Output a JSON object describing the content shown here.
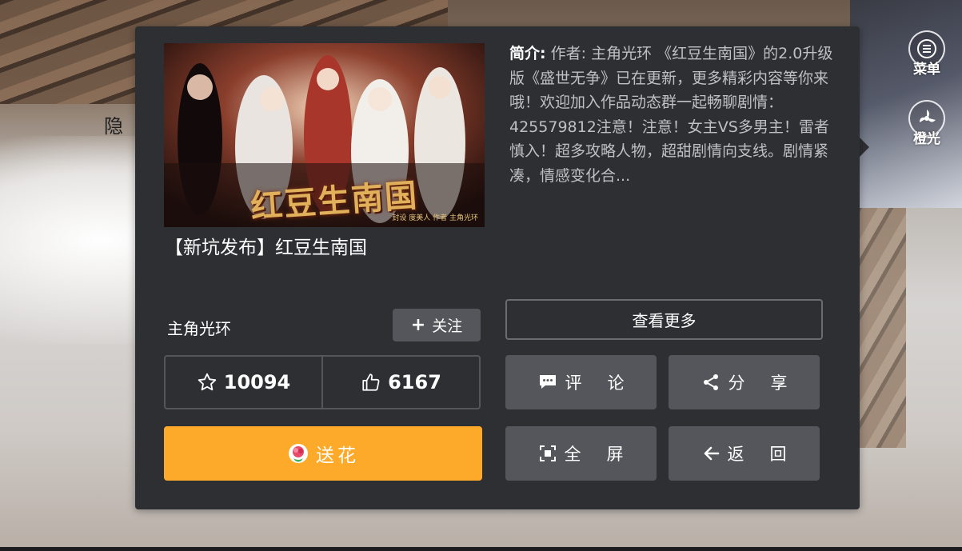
{
  "background": {
    "text": "隐"
  },
  "side_menu": {
    "menu_label": "菜单",
    "orange_label": "橙光"
  },
  "work": {
    "cover_title_art": "红豆生南国",
    "cover_credit": "封设 度美人  作者 主角光环",
    "title": "【新坑发布】红豆生南国",
    "intro_label": "简介:",
    "intro_text": "作者: 主角光环 《红豆生南国》的2.0升级版《盛世无争》已在更新，更多精彩内容等你来哦！欢迎加入作品动态群一起畅聊剧情：425579812注意！注意！女主VS多男主！雷者慎入！超多攻略人物，超甜剧情向支线。剧情紧凑，情感变化合..."
  },
  "author": {
    "name": "主角光环",
    "follow_label": "关注"
  },
  "stats": {
    "favorites": "10094",
    "likes": "6167"
  },
  "actions": {
    "flower_label": "送花",
    "more_label": "查看更多",
    "comment_label": "评论",
    "share_label": "分享",
    "fullscreen_label": "全屏",
    "back_label": "返回"
  },
  "colors": {
    "panel_bg": "#2e2f33",
    "button_gray": "#55565b",
    "flower_orange": "#fdaa2a",
    "intro_text": "#bfc0c4"
  },
  "icons": [
    "menu-icon",
    "orange-icon",
    "star-icon",
    "thumbs-up-icon",
    "flower-icon",
    "comment-icon",
    "share-icon",
    "fullscreen-icon",
    "back-arrow-icon",
    "plus-icon"
  ]
}
